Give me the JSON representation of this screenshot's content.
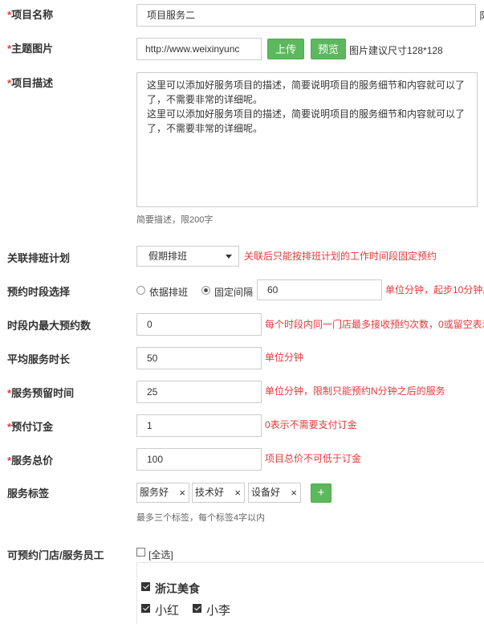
{
  "form": {
    "required_mark": "*",
    "name": {
      "label": "项目名称",
      "value": "项目服务二",
      "right_clip": "阝"
    },
    "image": {
      "label": "主题图片",
      "value": "http://www.weixinyunc",
      "upload": "上传",
      "preview": "预览",
      "hint": "图片建议尺寸128*128"
    },
    "description": {
      "label": "项目描述",
      "lines": [
        "这里可以添加好服务项目的描述，简要说明项目的服务细节和内容就可以了",
        "了，不需要非常的详细呢。",
        "这里可以添加好服务项目的描述，简要说明项目的服务细节和内容就可以了",
        "了，不需要非常的详细呢。"
      ],
      "hint": "简要描述，限200字"
    },
    "schedule": {
      "label": "关联排班计划",
      "selected": "假期排班",
      "hint": "关联后只能按排班计划的工作时间段固定预约"
    },
    "slot": {
      "label": "预约时段选择",
      "option1": "依据排班",
      "option2": "固定间隔",
      "value": "60",
      "hint": "单位分钟，起步10分钟。"
    },
    "max_per_slot": {
      "label": "时段内最大预约数",
      "value": "0",
      "hint": "每个时段内同一门店最多接收预约次数，0或留空表示"
    },
    "avg_duration": {
      "label": "平均服务时长",
      "value": "50",
      "hint": "单位分钟"
    },
    "reserve_time": {
      "label": "服务预留时间",
      "value": "25",
      "hint": "单位分钟，限制只能预约N分钟之后的服务"
    },
    "deposit": {
      "label": "预付订金",
      "value": "1",
      "hint": "0表示不需要支付订金"
    },
    "total_price": {
      "label": "服务总价",
      "value": "100",
      "hint": "项目总价不可低于订金"
    },
    "tags": {
      "label": "服务标签",
      "items": [
        "服务好",
        "技术好",
        "设备好"
      ],
      "close": "×",
      "add": "+",
      "hint": "最多三个标签，每个标签4字以内"
    },
    "stores": {
      "label": "可预约门店/服务员工",
      "select_all": "[全选]",
      "store_name": "浙江美食",
      "staff": [
        "小红",
        "小李"
      ]
    }
  }
}
